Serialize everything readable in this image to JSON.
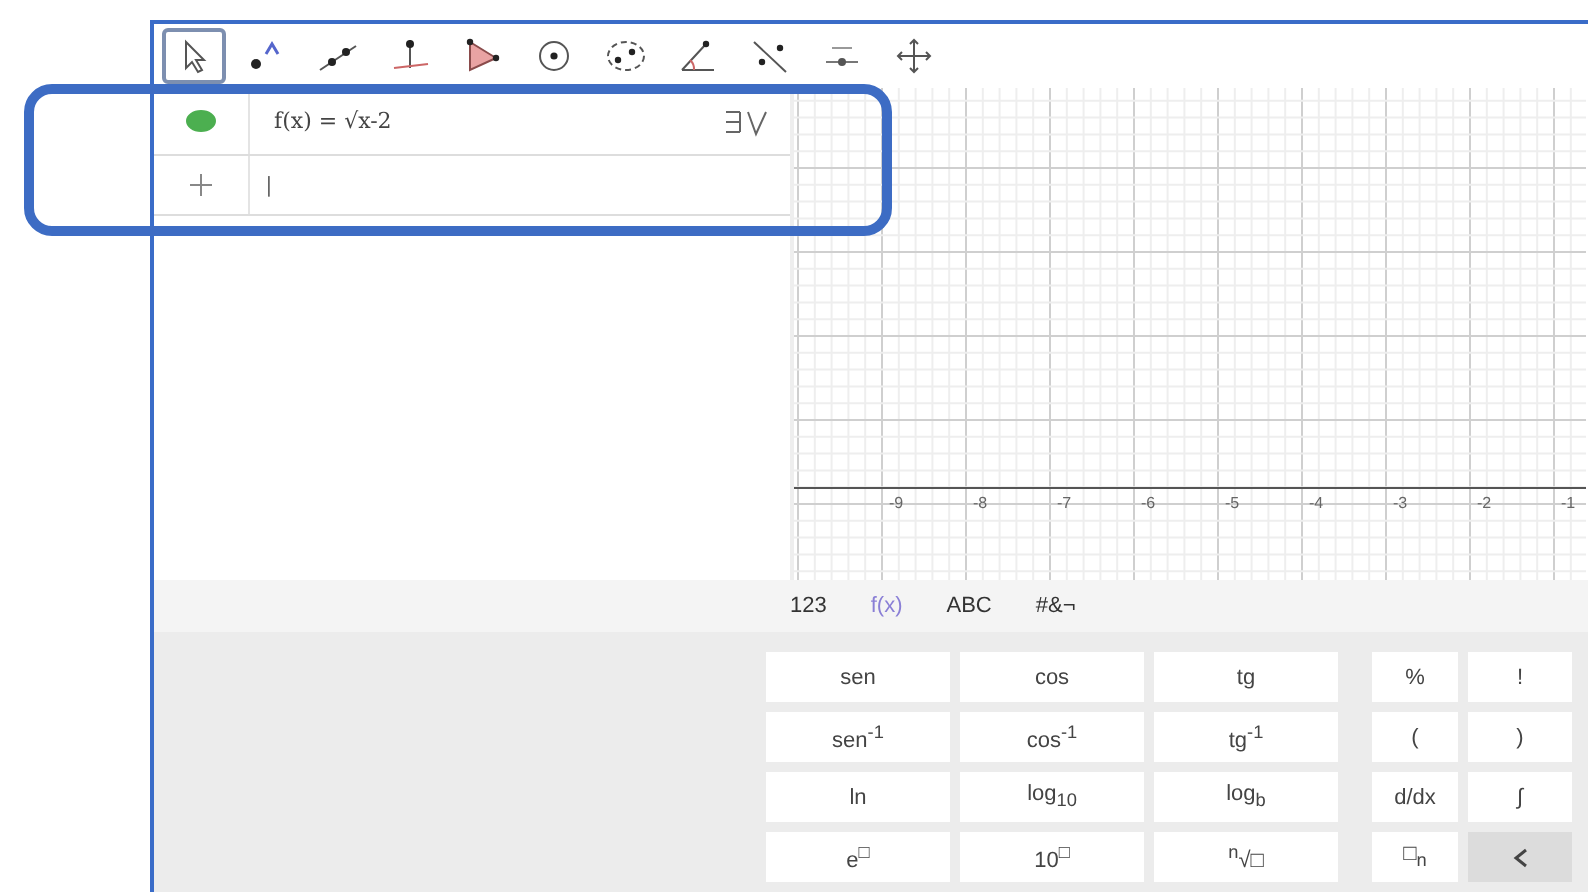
{
  "toolbar": {
    "tools": [
      {
        "kind": "move",
        "selected": true
      },
      {
        "kind": "point",
        "selected": false
      },
      {
        "kind": "line",
        "selected": false
      },
      {
        "kind": "perpendicular",
        "selected": false
      },
      {
        "kind": "polygon",
        "selected": false
      },
      {
        "kind": "circle",
        "selected": false
      },
      {
        "kind": "conic",
        "selected": false
      },
      {
        "kind": "angle",
        "selected": false
      },
      {
        "kind": "reflect",
        "selected": false
      },
      {
        "kind": "slider",
        "selected": false
      },
      {
        "kind": "pan",
        "selected": false
      }
    ]
  },
  "algebra": {
    "entries": [
      {
        "visible": true,
        "color": "#4caf50",
        "formula": "f(x) = √x-2"
      }
    ],
    "input": {
      "value": "|"
    }
  },
  "graphics": {
    "x_labels": [
      "-9",
      "-8",
      "-7",
      "-6",
      "-5",
      "-4",
      "-3",
      "-2",
      "-1"
    ]
  },
  "keyboard": {
    "tabs": [
      {
        "label": "123",
        "selected": false
      },
      {
        "label": "f(x)",
        "selected": true
      },
      {
        "label": "ABC",
        "selected": false
      },
      {
        "label": "#&¬",
        "selected": false
      }
    ],
    "rows": [
      [
        "sen",
        "cos",
        "tg",
        "%",
        "!"
      ],
      [
        "sen$^{-1}$",
        "cos$^{-1}$",
        "tg$^{-1}$",
        "(",
        ")"
      ],
      [
        "ln",
        "log$_{10}$",
        "log$_{b}$",
        "d/dx",
        "∫"
      ],
      [
        "e$^{□}$",
        "10$^{□}$",
        "$^{n}$√□",
        "□$_{n}$",
        {
          "kind": "backspace"
        }
      ]
    ]
  }
}
